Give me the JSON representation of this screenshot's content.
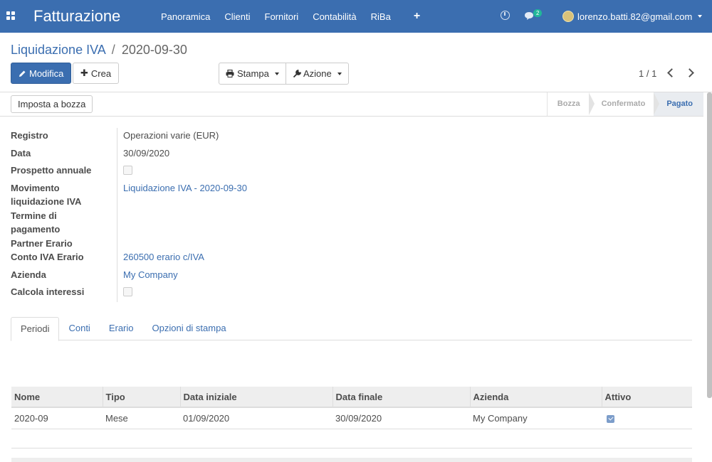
{
  "navbar": {
    "brand": "Fatturazione",
    "menu": [
      "Panoramica",
      "Clienti",
      "Fornitori",
      "Contabilità",
      "RiBa"
    ],
    "plus": "+",
    "chat_count": "2",
    "user_email": "lorenzo.batti.82@gmail.com",
    "accent": "#3b6eb0"
  },
  "breadcrumb": {
    "parent": "Liquidazione IVA",
    "separator": "/",
    "current": "2020-09-30"
  },
  "buttons": {
    "edit": "Modifica",
    "create": "Crea",
    "print": "Stampa",
    "action": "Azione"
  },
  "pager": {
    "value": "1 / 1"
  },
  "statusbar": {
    "draft_button": "Imposta a bozza",
    "states": [
      "Bozza",
      "Confermato",
      "Pagato"
    ],
    "active_state": "Pagato"
  },
  "form": {
    "registro_label": "Registro",
    "registro_value": "Operazioni varie (EUR)",
    "data_label": "Data",
    "data_value": "30/09/2020",
    "prospetto_label": "Prospetto annuale",
    "movimento_label_1": "Movimento",
    "movimento_label_2": "liquidazione IVA",
    "movimento_value": "Liquidazione IVA - 2020-09-30",
    "termine_label_1": "Termine di",
    "termine_label_2": "pagamento",
    "partner_label": "Partner Erario",
    "conto_label": "Conto IVA Erario",
    "conto_value": "260500 erario c/IVA",
    "azienda_label": "Azienda",
    "azienda_value": "My Company",
    "calcola_label": "Calcola interessi"
  },
  "tabs": [
    "Periodi",
    "Conti",
    "Erario",
    "Opzioni di stampa"
  ],
  "table": {
    "headers": [
      "Nome",
      "Tipo",
      "Data iniziale",
      "Data finale",
      "Azienda",
      "Attivo"
    ],
    "rows": [
      {
        "nome": "2020-09",
        "tipo": "Mese",
        "data_iniziale": "01/09/2020",
        "data_finale": "30/09/2020",
        "azienda": "My Company",
        "attivo": true
      }
    ]
  }
}
